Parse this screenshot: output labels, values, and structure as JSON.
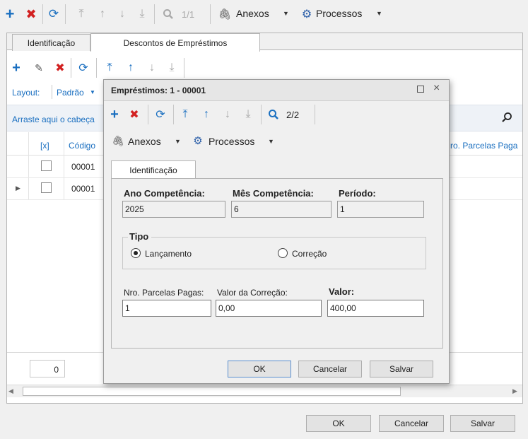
{
  "top_toolbar": {
    "page": "1/1",
    "anexos": "Anexos",
    "processos": "Processos"
  },
  "tabs": [
    "Identificação",
    "Descontos de Empréstimos"
  ],
  "sub_toolbar": {
    "page": "2/2"
  },
  "layout": {
    "label": "Layout:",
    "value": "Padrão"
  },
  "grid": {
    "group_hint": "Arraste aqui o cabeça",
    "columns": [
      "[x]",
      "Código",
      "ro. Parcelas Paga"
    ],
    "rows": [
      {
        "codigo": "00001"
      },
      {
        "codigo": "00001"
      }
    ],
    "footer_count": "0"
  },
  "footer_buttons": {
    "ok": "OK",
    "cancel": "Cancelar",
    "save": "Salvar"
  },
  "dialog": {
    "title": "Empréstimos: 1 - 00001",
    "page": "2/2",
    "anexos": "Anexos",
    "processos": "Processos",
    "tab": "Identificação",
    "ano_label": "Ano Competência:",
    "ano_value": "2025",
    "mes_label": "Mês Competência:",
    "mes_value": "6",
    "periodo_label": "Período:",
    "periodo_value": "1",
    "tipo_label": "Tipo",
    "radio_lancamento": "Lançamento",
    "radio_correcao": "Correção",
    "selected_tipo": "Lançamento",
    "parcelas_label": "Nro. Parcelas Pagas:",
    "parcelas_value": "1",
    "correcao_label": "Valor da Correção:",
    "correcao_value": "0,00",
    "valor_label": "Valor:",
    "valor_value": "400,00",
    "ok": "OK",
    "cancel": "Cancelar",
    "save": "Salvar"
  }
}
